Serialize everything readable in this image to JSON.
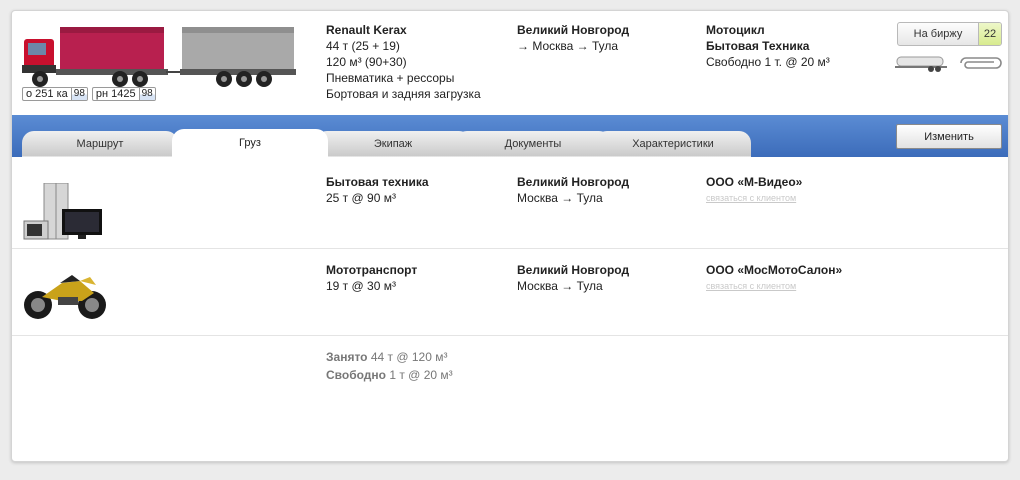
{
  "vehicle": {
    "model": "Renault Kerax",
    "weight": "44 т (25 + 19)",
    "volume": "120 м³ (90+30)",
    "suspension": "Пневматика + рессоры",
    "loading": "Бортовая и задняя загрузка",
    "plate1": {
      "number": "о 251 ка",
      "region": "98"
    },
    "plate2": {
      "number": "рн 1425",
      "region": "98"
    }
  },
  "header_route": {
    "from": "Великий Новгород",
    "via": "→ Москва → Тула"
  },
  "header_cargo": {
    "line1": "Мотоцикл",
    "line2": "Бытовая Техника",
    "free": "Свободно 1 т. @ 20 м³"
  },
  "birzha": {
    "label": "На биржу",
    "count": "22"
  },
  "tabs": [
    {
      "label": "Маршрут"
    },
    {
      "label": "Груз"
    },
    {
      "label": "Экипаж"
    },
    {
      "label": "Документы"
    },
    {
      "label": "Характеристики"
    }
  ],
  "edit_label": "Изменить",
  "cargo_rows": [
    {
      "title": "Бытовая техника",
      "amount": "25 т @ 90 м³",
      "from": "Великий Новгород",
      "route": "Москва → Тула",
      "client": "ООО «М-Видео»",
      "contact": "связаться с клиентом"
    },
    {
      "title": "Мототранспорт",
      "amount": "19 т @ 30 м³",
      "from": "Великий Новгород",
      "route": "Москва → Тула",
      "client": "ООО «МосМотоСалон»",
      "contact": "связаться с клиентом"
    }
  ],
  "summary": {
    "busy_label": "Занято",
    "busy_value": "44 т @ 120 м³",
    "free_label": "Свободно",
    "free_value": "1 т @ 20 м³"
  },
  "colors": {
    "tabbar": "#4a7cc8",
    "truck_cab": "#c8102e",
    "truck_cargo": "#b8204f",
    "trailer": "#a9a9a9",
    "counter": "#d8eb8e"
  }
}
